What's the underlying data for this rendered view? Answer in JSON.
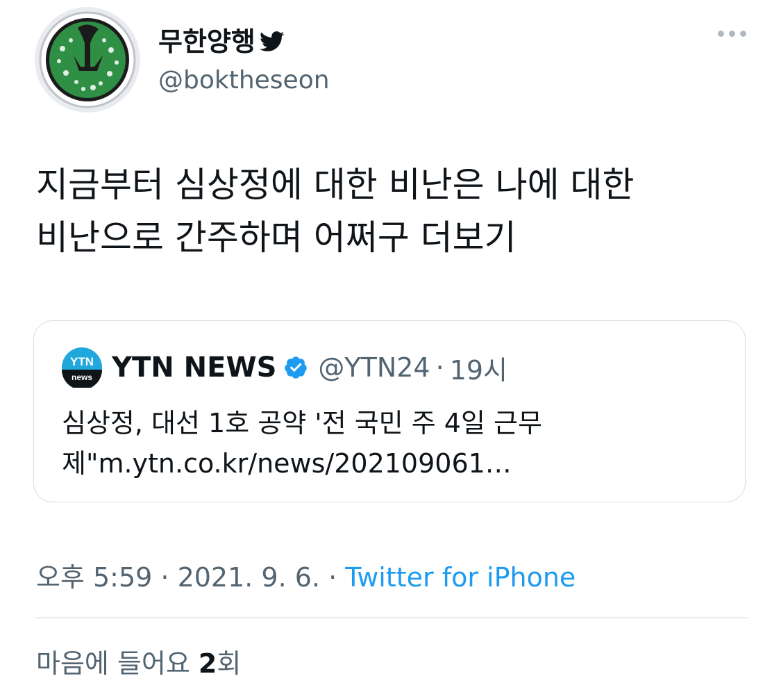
{
  "author": {
    "display_name": "무한양행",
    "handle": "@boktheseon",
    "avatar_icon": "green-emblem-avatar-icon",
    "bird_icon": "twitter-bird-icon"
  },
  "tweet": {
    "text_lines": [
      "지금부터 심상정에 대한 비난은 나에 대한",
      "비난으로 간주하며 어쩌구 더보기"
    ]
  },
  "quote": {
    "logo_text_top": "YTN",
    "logo_text_bottom": "news",
    "name": "YTN NEWS",
    "handle": "@YTN24",
    "separator": "·",
    "time": "19시",
    "text_lines": [
      "심상정, 대선 1호 공약 '전 국민 주 4일 근무",
      "제\"m.ytn.co.kr/news/202109061…"
    ]
  },
  "meta": {
    "time_date": "오후 5:59 · 2021. 9. 6. · ",
    "source": "Twitter for iPhone"
  },
  "likes": {
    "prefix": "마음에 들어요 ",
    "count": "2",
    "suffix": "회"
  },
  "colors": {
    "text": "#0f1419",
    "secondary": "#536471",
    "link": "#1d9bf0",
    "verified": "#1d9bf0",
    "border": "#d6dce0"
  }
}
